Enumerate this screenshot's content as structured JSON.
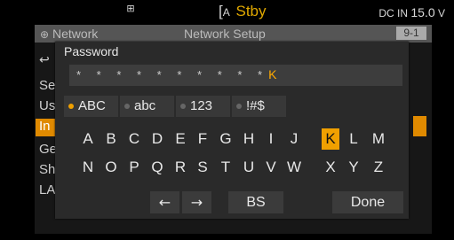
{
  "status_bar": {
    "network_symbol": "⊞",
    "stby_icon": "[",
    "stby_letter": "A",
    "stby_label": "Stby",
    "power_prefix": "DC IN",
    "power_value": "15.0",
    "power_unit": "V"
  },
  "background_menu": {
    "title": "Network",
    "subtitle": "Network Setup",
    "page": "9-1",
    "items": [
      "Se",
      "Us",
      "In",
      "Ge",
      "Sh",
      "LA"
    ],
    "selected_index": 2
  },
  "dialog": {
    "title": "Password",
    "password_masked": "* * * * * * * * * *",
    "password_last": "K",
    "tabs": [
      {
        "label": "ABC",
        "active": true
      },
      {
        "label": "abc",
        "active": false
      },
      {
        "label": "123",
        "active": false
      },
      {
        "label": "!#$",
        "active": false
      }
    ],
    "keys_row1": [
      "A",
      "B",
      "C",
      "D",
      "E",
      "F",
      "G",
      "H",
      "I",
      "J",
      "K",
      "L",
      "M"
    ],
    "keys_row2": [
      "N",
      "O",
      "P",
      "Q",
      "R",
      "S",
      "T",
      "U",
      "V",
      "W",
      "X",
      "Y",
      "Z"
    ],
    "selected_key": "K",
    "left_arrow": "←",
    "right_arrow": "→",
    "backspace_label": "BS",
    "done_label": "Done"
  },
  "colors": {
    "accent": "#f0a000",
    "dialog_bg": "#2a2a2a",
    "key_bg": "#383838"
  }
}
